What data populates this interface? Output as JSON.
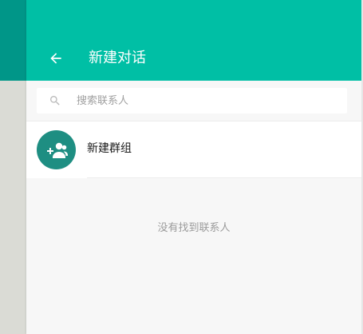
{
  "header": {
    "title": "新建对话",
    "back_icon": "arrow-left-icon"
  },
  "search": {
    "placeholder": "搜索联系人",
    "value": "",
    "icon": "search-icon"
  },
  "list": {
    "items": [
      {
        "label": "新建群组",
        "icon": "add-group-icon"
      }
    ]
  },
  "empty_state": {
    "text": "没有找到联系人"
  },
  "colors": {
    "header": "#00bfa5",
    "accent_dark": "#009688",
    "avatar": "#1e8e82"
  }
}
